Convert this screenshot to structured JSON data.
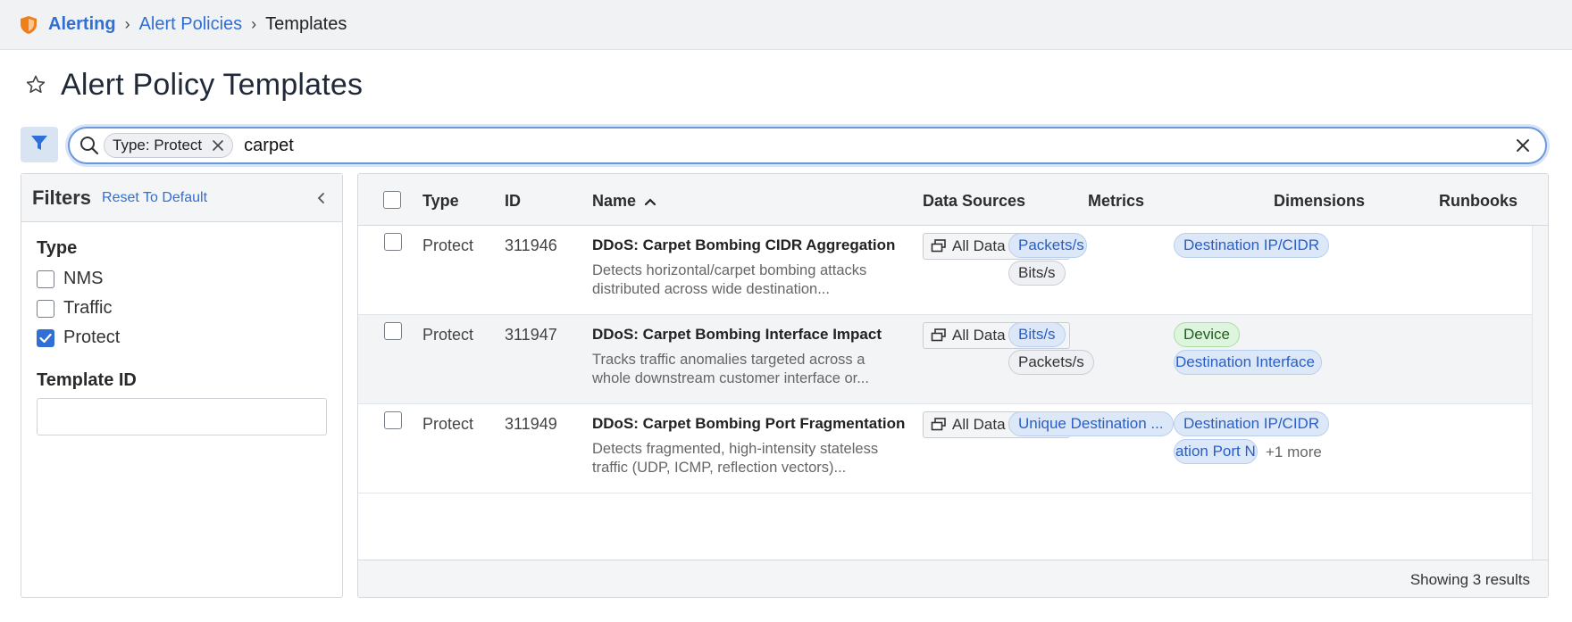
{
  "breadcrumb": {
    "items": [
      "Alerting",
      "Alert Policies"
    ],
    "current": "Templates"
  },
  "page": {
    "title": "Alert Policy Templates"
  },
  "search": {
    "chip_label": "Type: Protect",
    "query": "carpet"
  },
  "filters": {
    "title": "Filters",
    "reset_label": "Reset To Default",
    "type_title": "Type",
    "type_options": [
      {
        "label": "NMS",
        "checked": false
      },
      {
        "label": "Traffic",
        "checked": false
      },
      {
        "label": "Protect",
        "checked": true
      }
    ],
    "template_id_title": "Template ID",
    "template_id_value": ""
  },
  "table": {
    "columns": [
      "Type",
      "ID",
      "Name",
      "Data Sources",
      "Metrics",
      "Dimensions",
      "Runbooks"
    ],
    "rows": [
      {
        "type": "Protect",
        "id": "311946",
        "name": "DDoS: Carpet Bombing CIDR Aggregation",
        "description_1": "Detects horizontal/carpet bombing attacks",
        "description_2": "distributed across wide destination...",
        "data_source": "All Data Sour...",
        "metrics": [
          "Packets/s",
          "Bits/s"
        ],
        "dimensions": [
          "Destination IP/CIDR"
        ]
      },
      {
        "type": "Protect",
        "id": "311947",
        "name": "DDoS: Carpet Bombing Interface Impact",
        "description_1": "Tracks traffic anomalies targeted across a",
        "description_2": "whole downstream customer interface or...",
        "data_source": "All Data Sour...",
        "metrics": [
          "Bits/s",
          "Packets/s"
        ],
        "dimensions": [
          "Device",
          "Destination Interface"
        ]
      },
      {
        "type": "Protect",
        "id": "311949",
        "name": "DDoS: Carpet Bombing Port Fragmentation",
        "description_1": "Detects fragmented, high-intensity stateless",
        "description_2": "traffic (UDP, ICMP, reflection vectors)...",
        "data_source": "All Data Sour...",
        "metrics": [
          "Unique Destination ..."
        ],
        "dimensions": [
          "Destination IP/CIDR",
          "ation Port N"
        ],
        "more": "+1 more"
      }
    ],
    "footer": "Showing 3 results"
  },
  "colors": {
    "accent": "#2f6fd6",
    "brand_orange": "#f07f1a",
    "device_green": "#dcf5dc"
  }
}
